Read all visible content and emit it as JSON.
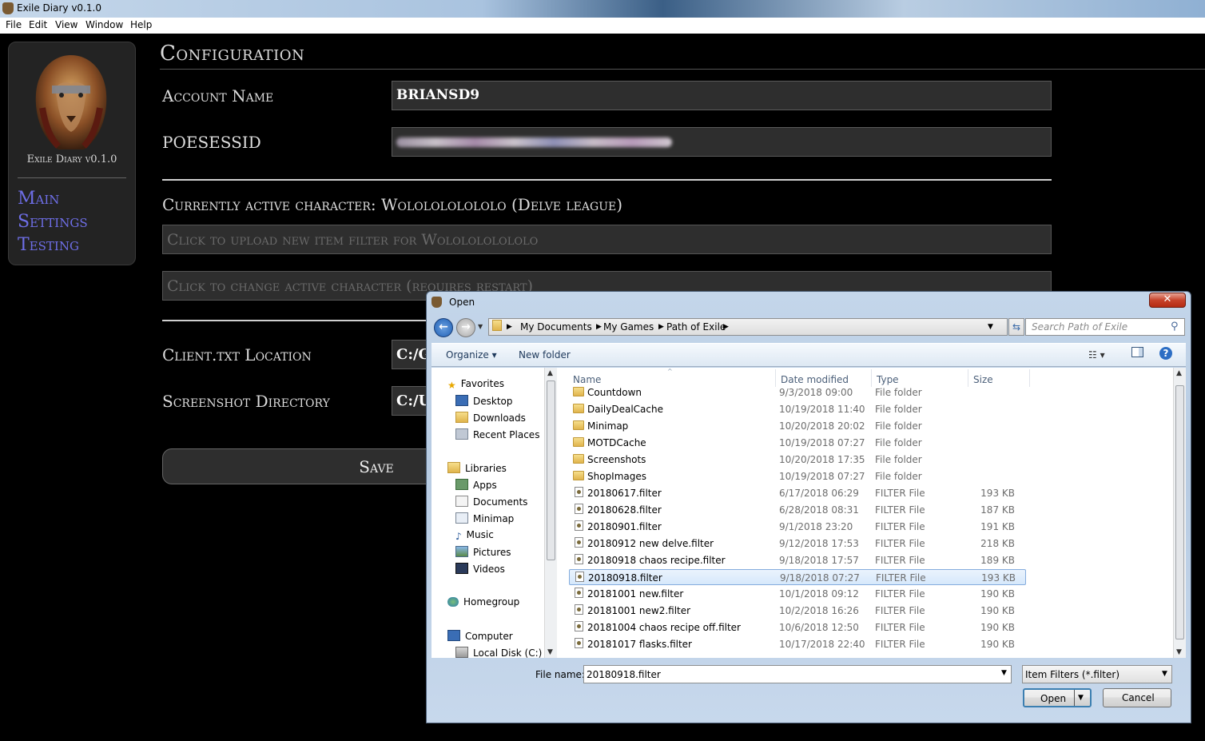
{
  "window": {
    "title": "Exile Diary v0.1.0"
  },
  "menu": [
    "File",
    "Edit",
    "View",
    "Window",
    "Help"
  ],
  "sidebar": {
    "version": "Exile Diary v0.1.0",
    "nav": [
      "Main",
      "Settings",
      "Testing"
    ]
  },
  "config": {
    "heading": "Configuration",
    "account_label": "Account Name",
    "account_value": "BRIANSD9",
    "poesessid_label": "POESESSID",
    "active_character": "Currently active character: Wololololololo (Delve league)",
    "upload_filter": "Click to upload new item filter for Wololololololo",
    "change_character": "Click to change active character (requires restart)",
    "client_label": "Client.txt Location",
    "client_value": "C:/G",
    "screenshot_label": "Screenshot Directory",
    "screenshot_value": "C:/U",
    "save_label": "Save"
  },
  "dialog": {
    "title": "Open",
    "close": "✕",
    "breadcrumb": [
      "My Documents",
      "My Games",
      "Path of Exile"
    ],
    "search_placeholder": "Search Path of Exile",
    "organize": "Organize ▾",
    "new_folder": "New folder",
    "nav_pane": {
      "favorites": "Favorites",
      "fav_items": [
        "Desktop",
        "Downloads",
        "Recent Places"
      ],
      "libraries": "Libraries",
      "lib_items": [
        "Apps",
        "Documents",
        "Minimap",
        "Music",
        "Pictures",
        "Videos"
      ],
      "homegroup": "Homegroup",
      "computer": "Computer",
      "local_disk": "Local Disk (C:)"
    },
    "columns": [
      "Name",
      "Date modified",
      "Type",
      "Size"
    ],
    "files": [
      {
        "name": "Countdown",
        "date": "9/3/2018 09:00",
        "type": "File folder",
        "size": "",
        "folder": true
      },
      {
        "name": "DailyDealCache",
        "date": "10/19/2018 11:40",
        "type": "File folder",
        "size": "",
        "folder": true
      },
      {
        "name": "Minimap",
        "date": "10/20/2018 20:02",
        "type": "File folder",
        "size": "",
        "folder": true
      },
      {
        "name": "MOTDCache",
        "date": "10/19/2018 07:27",
        "type": "File folder",
        "size": "",
        "folder": true
      },
      {
        "name": "Screenshots",
        "date": "10/20/2018 17:35",
        "type": "File folder",
        "size": "",
        "folder": true
      },
      {
        "name": "ShopImages",
        "date": "10/19/2018 07:27",
        "type": "File folder",
        "size": "",
        "folder": true
      },
      {
        "name": "20180617.filter",
        "date": "6/17/2018 06:29",
        "type": "FILTER File",
        "size": "193 KB",
        "folder": false
      },
      {
        "name": "20180628.filter",
        "date": "6/28/2018 08:31",
        "type": "FILTER File",
        "size": "187 KB",
        "folder": false
      },
      {
        "name": "20180901.filter",
        "date": "9/1/2018 23:20",
        "type": "FILTER File",
        "size": "191 KB",
        "folder": false
      },
      {
        "name": "20180912 new delve.filter",
        "date": "9/12/2018 17:53",
        "type": "FILTER File",
        "size": "218 KB",
        "folder": false
      },
      {
        "name": "20180918 chaos recipe.filter",
        "date": "9/18/2018 17:57",
        "type": "FILTER File",
        "size": "189 KB",
        "folder": false
      },
      {
        "name": "20180918.filter",
        "date": "9/18/2018 07:27",
        "type": "FILTER File",
        "size": "193 KB",
        "folder": false,
        "selected": true
      },
      {
        "name": "20181001 new.filter",
        "date": "10/1/2018 09:12",
        "type": "FILTER File",
        "size": "190 KB",
        "folder": false
      },
      {
        "name": "20181001 new2.filter",
        "date": "10/2/2018 16:26",
        "type": "FILTER File",
        "size": "190 KB",
        "folder": false
      },
      {
        "name": "20181004 chaos recipe off.filter",
        "date": "10/6/2018 12:50",
        "type": "FILTER File",
        "size": "190 KB",
        "folder": false
      },
      {
        "name": "20181017 flasks.filter",
        "date": "10/17/2018 22:40",
        "type": "FILTER File",
        "size": "190 KB",
        "folder": false
      }
    ],
    "file_name_label": "File name:",
    "file_name_value": "20180918.filter",
    "file_type": "Item Filters (*.filter)",
    "open_label": "Open",
    "cancel_label": "Cancel"
  }
}
